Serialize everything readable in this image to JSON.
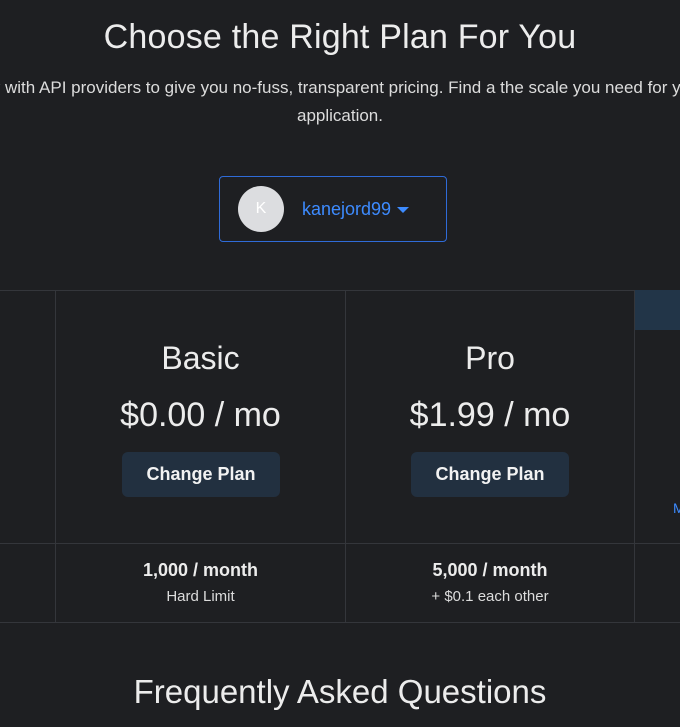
{
  "header": {
    "title": "Choose the Right Plan For You",
    "subtitle": "ctly with API providers to give you no-fuss, transparent pricing. Find a the scale you need for your application."
  },
  "account": {
    "avatar_initial": "K",
    "username": "kanejord99"
  },
  "plans": [
    {
      "name": "Basic",
      "price": "$0.00 / mo",
      "button_label": "Change Plan",
      "limit_main": "1,000 / month",
      "limit_sub": "Hard Limit"
    },
    {
      "name": "Pro",
      "price": "$1.99 / mo",
      "button_label": "Change Plan",
      "limit_main": "5,000 / month",
      "limit_sub": "+ $0.1 each other"
    }
  ],
  "partial_link_text": "M",
  "faq": {
    "title": "Frequently Asked Questions"
  },
  "colors": {
    "background": "#1e1f22",
    "accent": "#3d8bff",
    "button_bg": "#223040",
    "divider": "#34363b"
  }
}
